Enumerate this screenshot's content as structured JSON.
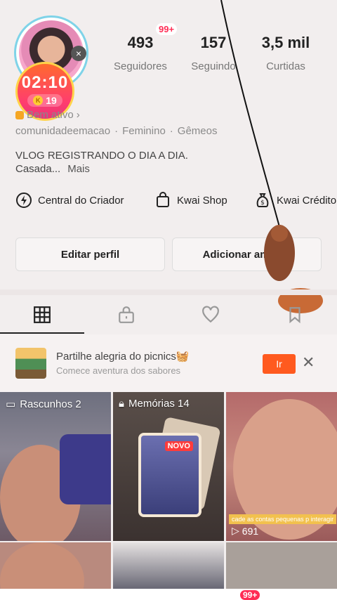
{
  "profile": {
    "timer": "02:10",
    "coins": "19",
    "coin_symbol": "K",
    "active_status": "Bem ativo",
    "username": "comunidadeemacao",
    "gender": "Feminino",
    "sign": "Gêmeos",
    "bio_line1": "VLOG REGISTRANDO O DIA A DIA.",
    "bio_line2": "Casada...",
    "bio_more": "Mais"
  },
  "stats": [
    {
      "value": "493",
      "label": "Seguidores"
    },
    {
      "value": "157",
      "label": "Seguindo"
    },
    {
      "value": "3,5 mil",
      "label": "Curtidas"
    }
  ],
  "notification_badge": "99+",
  "shortcuts": [
    {
      "label": "Central do Criador",
      "icon": "lightning-icon"
    },
    {
      "label": "Kwai Shop",
      "icon": "shopping-bag-icon"
    },
    {
      "label": "Kwai Crédito",
      "icon": "money-bag-icon"
    }
  ],
  "buttons": {
    "edit_profile": "Editar perfil",
    "add_friends": "Adicionar amigos"
  },
  "tabs": [
    "grid-icon",
    "lock-icon",
    "heart-icon",
    "bookmark-icon"
  ],
  "promo": {
    "title": "Partilhe alegria do picnics🧺",
    "subtitle": "Comece aventura dos sabores",
    "cta": "Ir"
  },
  "grid": [
    {
      "label": "Rascunhos 2"
    },
    {
      "label": "Memórias 14",
      "badge": "NOVO"
    },
    {
      "views": "691",
      "caption": "cade as contas pequenas p interagir"
    }
  ],
  "colors": {
    "accent": "#ff5a1f",
    "badge": "#ff2d55",
    "timer": "#ff3d6e"
  }
}
